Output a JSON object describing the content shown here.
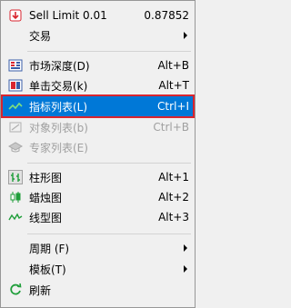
{
  "menu": {
    "header": {
      "symbol": "Sell Limit 0.01",
      "price": "0.87852"
    },
    "trade": {
      "label": "交易"
    },
    "market_depth": {
      "label": "市场深度(D)",
      "shortcut": "Alt+B"
    },
    "one_click": {
      "label": "单击交易(k)",
      "shortcut": "Alt+T"
    },
    "indicators_list": {
      "label": "指标列表(L)",
      "shortcut": "Ctrl+I"
    },
    "objects_list": {
      "label": "对象列表(b)",
      "shortcut": "Ctrl+B"
    },
    "experts_list": {
      "label": "专家列表(E)"
    },
    "bar_chart": {
      "label": "柱形图",
      "shortcut": "Alt+1"
    },
    "candlesticks": {
      "label": "蜡烛图",
      "shortcut": "Alt+2"
    },
    "line_chart": {
      "label": "线型图",
      "shortcut": "Alt+3"
    },
    "periodicity": {
      "label": "周期 (F)"
    },
    "templates": {
      "label": "模板(T)"
    },
    "refresh": {
      "label": "刷新"
    }
  },
  "colors": {
    "highlight": "#0078d7",
    "highlight_border": "#d9252f",
    "disabled_text": "#a0a0a0",
    "icon_red": "#d9252f",
    "icon_green": "#1f9e3a"
  }
}
